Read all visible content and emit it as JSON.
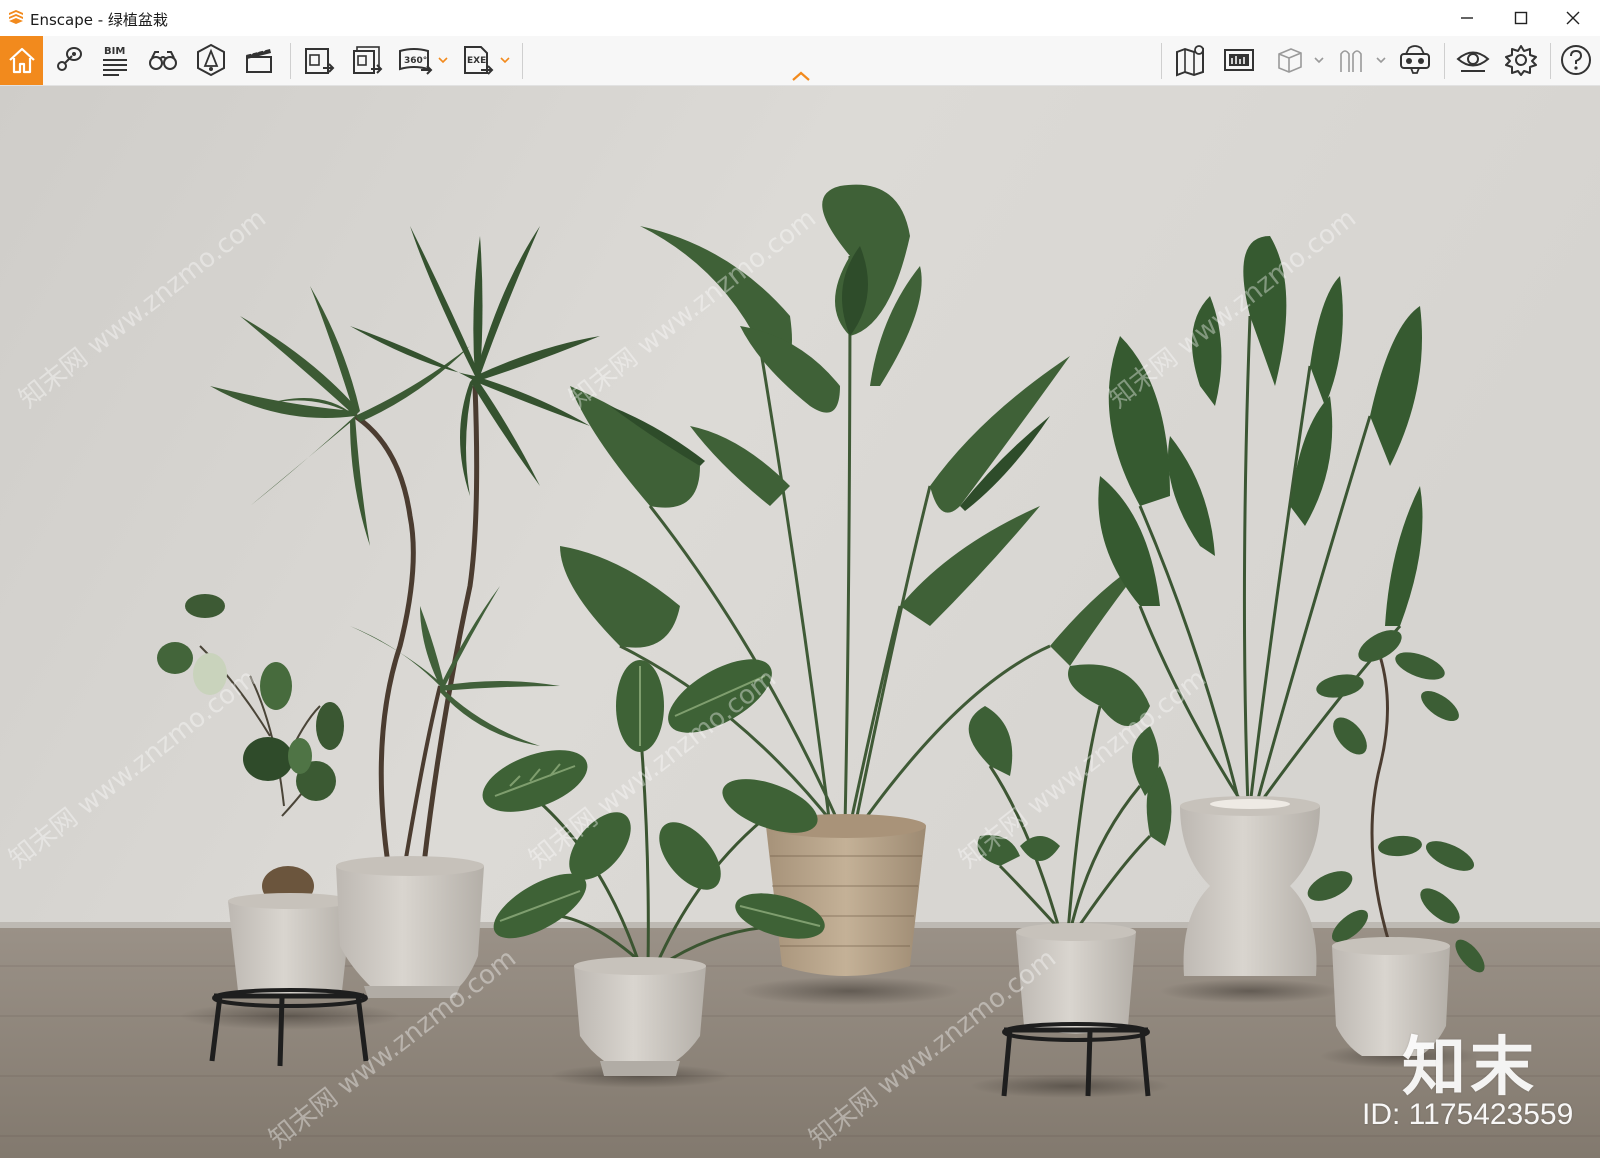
{
  "window": {
    "title": "Enscape - 绿植盆栽",
    "logo_icon": "enscape-logo-icon",
    "controls": [
      "minimize-icon",
      "maximize-icon",
      "close-icon"
    ]
  },
  "toolbar": {
    "left_tools": [
      {
        "name": "home",
        "icon": "home-icon",
        "active": true
      },
      {
        "name": "views",
        "icon": "views-map-pin-icon"
      },
      {
        "name": "bim",
        "icon": "bim-info-icon",
        "label": "BIM"
      },
      {
        "name": "binoculars",
        "icon": "binoculars-icon"
      },
      {
        "name": "asset-library",
        "icon": "asset-library-icon"
      },
      {
        "name": "video-editor",
        "icon": "clapperboard-icon"
      },
      {
        "name": "screenshot",
        "icon": "render-image-icon"
      },
      {
        "name": "batch-render",
        "icon": "batch-render-icon"
      },
      {
        "name": "panorama",
        "icon": "panorama-360-icon",
        "label": "360°",
        "has_dropdown": true
      },
      {
        "name": "export-exe",
        "icon": "export-exe-icon",
        "label": "EXE",
        "has_dropdown": true
      }
    ],
    "right_tools": [
      {
        "name": "map",
        "icon": "map-icon"
      },
      {
        "name": "minimap",
        "icon": "minimap-icon"
      },
      {
        "name": "cube-view",
        "icon": "cube-icon",
        "has_dropdown": true,
        "disabled": true
      },
      {
        "name": "people",
        "icon": "people-icon",
        "has_dropdown": true,
        "disabled": true
      },
      {
        "name": "vr",
        "icon": "vr-headset-icon"
      },
      {
        "name": "visual-settings",
        "icon": "eye-icon"
      },
      {
        "name": "general-settings",
        "icon": "gear-icon"
      },
      {
        "name": "help",
        "icon": "help-icon"
      }
    ],
    "collapse_icon": "chevron-up-icon"
  },
  "viewport": {
    "scene": "rendered-potted-plants",
    "watermark_brand": "知末",
    "watermark_id": "ID: 1175423559",
    "watermark_repeat": "知末网 www.znzmo.com"
  },
  "colors": {
    "accent": "#f28a1d",
    "wall": "#d9d7d3",
    "floor": "#8e8579",
    "leaf": "#3f5f36",
    "pot": "#cfcac4",
    "basket": "#b8a58c"
  }
}
